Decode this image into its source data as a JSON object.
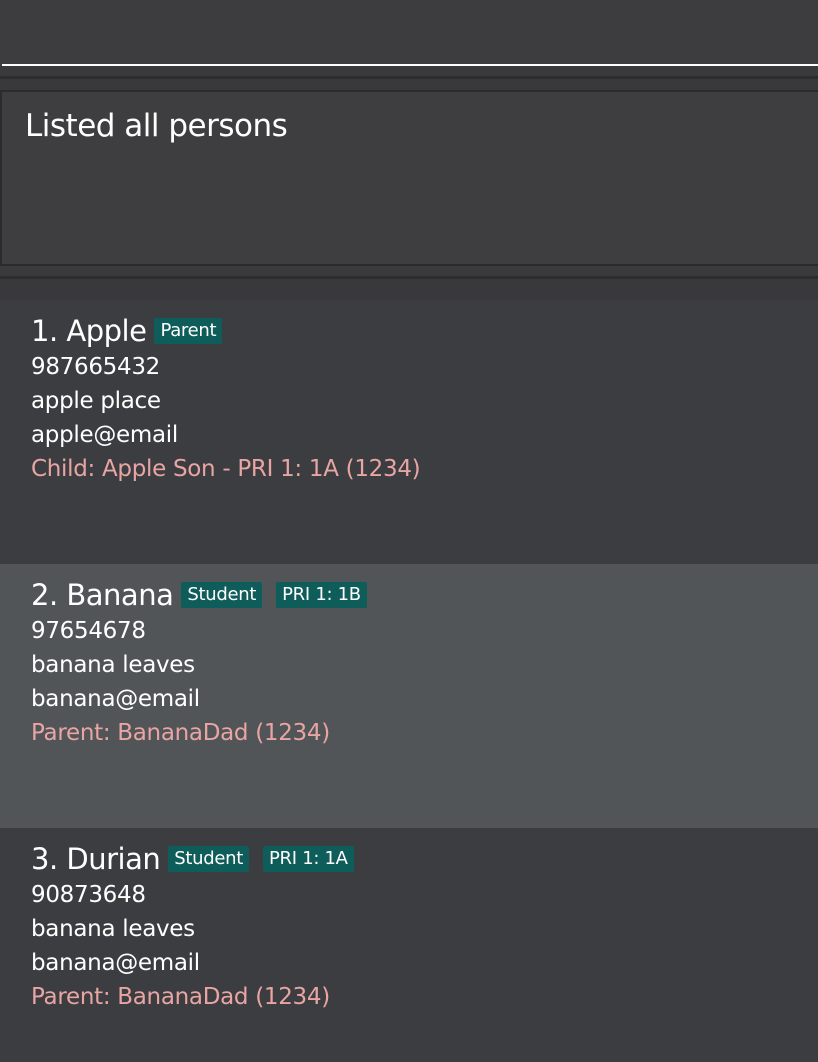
{
  "command_box": {
    "value": "",
    "placeholder": ""
  },
  "result_display": {
    "message": "Listed all persons"
  },
  "persons": [
    {
      "index_name": "1. Apple",
      "tags": [
        "Parent"
      ],
      "phone": "987665432",
      "address": "apple place",
      "email": "apple@email",
      "relation": "Child: Apple Son - PRI 1: 1A (1234)"
    },
    {
      "index_name": "2. Banana",
      "tags": [
        "Student",
        "PRI 1: 1B"
      ],
      "phone": "97654678",
      "address": "banana leaves",
      "email": "banana@email",
      "relation": "Parent: BananaDad (1234)"
    },
    {
      "index_name": "3. Durian",
      "tags": [
        "Student",
        "PRI 1: 1A"
      ],
      "phone": "90873648",
      "address": "banana leaves",
      "email": "banana@email",
      "relation": "Parent: BananaDad (1234)"
    }
  ],
  "colors": {
    "background": "#3c3c3e",
    "alt_row": "#515558",
    "tag": "#0f5d5a",
    "relation_text": "#e8a5a4",
    "text": "#ffffff"
  }
}
